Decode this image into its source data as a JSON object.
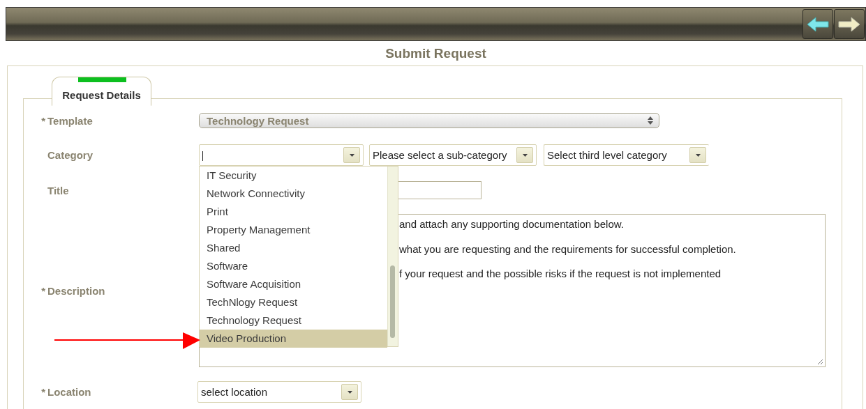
{
  "page_title": "Submit Request",
  "tabs": [
    {
      "label": "Request Details",
      "selected": true
    }
  ],
  "template": {
    "marker": "*",
    "label": "Template",
    "value": "Technology Request"
  },
  "category": {
    "label": "Category",
    "selects": [
      {
        "value": "Please select a sub-category"
      },
      {
        "value": "Select third level category"
      }
    ],
    "dropdown": {
      "items": [
        {
          "label": "IT Security",
          "selected": false
        },
        {
          "label": "Network Connectivity",
          "selected": false
        },
        {
          "label": "Print",
          "selected": false
        },
        {
          "label": "Property Management",
          "selected": false
        },
        {
          "label": "Shared",
          "selected": false
        },
        {
          "label": "Software",
          "selected": false
        },
        {
          "label": "Software Acquisition",
          "selected": false
        },
        {
          "label": "TechNlogy Request",
          "selected": false
        },
        {
          "label": "Technology Request",
          "selected": false
        },
        {
          "label": "Video Production",
          "selected": true
        }
      ]
    }
  },
  "title": {
    "label": "Title"
  },
  "description": {
    "marker": "*",
    "label": "Description",
    "lines": [
      "and attach any supporting documentation below.",
      "what you are requesting and the requirements for successful completion.",
      "f your request and the possible risks if the request is not implemented"
    ]
  },
  "location": {
    "marker": "*",
    "label": "Location",
    "value": "select location"
  }
}
